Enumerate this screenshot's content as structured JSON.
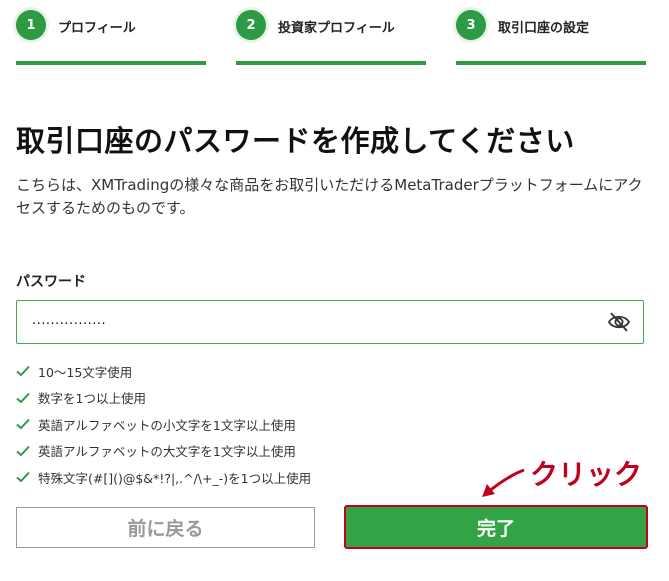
{
  "steps": [
    {
      "number": "1",
      "label": "プロフィール"
    },
    {
      "number": "2",
      "label": "投資家プロフィール"
    },
    {
      "number": "3",
      "label": "取引口座の設定"
    }
  ],
  "page": {
    "title": "取引口座のパスワードを作成してください",
    "description": "こちらは、XMTradingの様々な商品をお取引いただけるMetaTraderプラットフォームにアクセスするためのものです。"
  },
  "password": {
    "label": "パスワード",
    "value": "................"
  },
  "rules": [
    "10〜15文字使用",
    "数字を1つ以上使用",
    "英語アルファベットの小文字を1文字以上使用",
    "英語アルファベットの大文字を1文字以上使用",
    "特殊文字(#[]()@$&*!?|,.^/\\+_-)を1つ以上使用"
  ],
  "buttons": {
    "back": "前に戻る",
    "done": "完了"
  },
  "annotation": {
    "text": "クリック"
  },
  "colors": {
    "accent_green": "#2e9a43",
    "annotation_red": "#c0001e"
  },
  "icons": {
    "password_toggle": "eye-slash-icon",
    "rule_marker": "check-icon"
  }
}
